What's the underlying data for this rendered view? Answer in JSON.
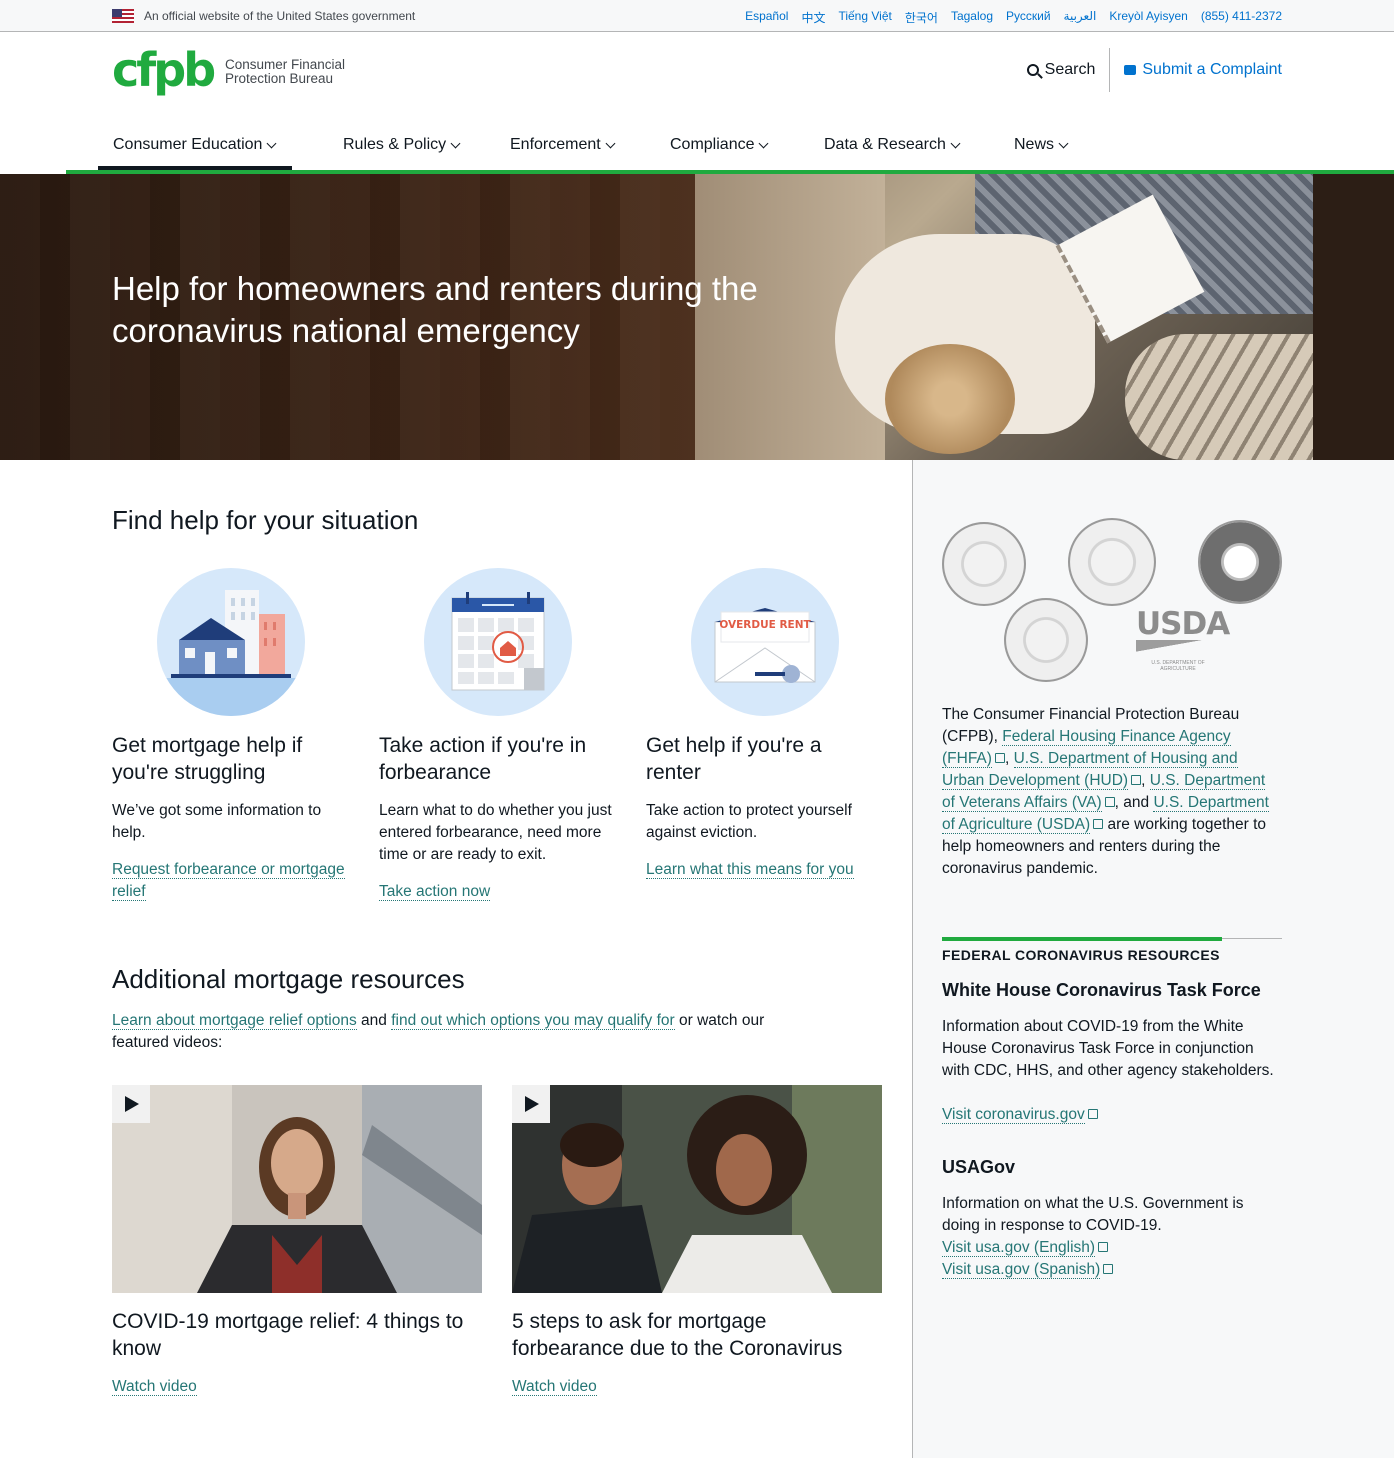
{
  "govbar": {
    "text": "An official website of the United States government",
    "languages": [
      "Español",
      "中文",
      "Tiếng Việt",
      "한국어",
      "Tagalog",
      "Русский",
      "العربية",
      "Kreyòl Ayisyen",
      "(855) 411-2372"
    ]
  },
  "header": {
    "logo_mark": "cfpb",
    "logo_text_1": "Consumer Financial",
    "logo_text_2": "Protection Bureau",
    "search_label": "Search",
    "complaint_label": "Submit a Complaint"
  },
  "nav": {
    "items": [
      "Consumer Education",
      "Rules & Policy",
      "Enforcement",
      "Compliance",
      "Data & Research",
      "News"
    ]
  },
  "hero": {
    "title": "Help for homeowners and renters during the coronavirus national emergency"
  },
  "situation": {
    "heading": "Find help for your situation",
    "cards": [
      {
        "title": "Get mortgage help if you're struggling",
        "text": "We’ve got some information to help.",
        "link": "Request forbearance or mortgage relief"
      },
      {
        "title": "Take action if you're in forbearance",
        "text": "Learn what to do whether you just entered forbearance, need more time or are ready to exit.",
        "link": "Take action now"
      },
      {
        "title": "Get help if you're a renter",
        "text": "Take action to protect yourself against eviction.",
        "link": "Learn what this means for you",
        "icon_text": "OVERDUE RENT"
      }
    ]
  },
  "resources": {
    "heading": "Additional mortgage resources",
    "intro_link_1": "Learn about mortgage relief options",
    "intro_mid": " and ",
    "intro_link_2": "find out which options you may qualify for",
    "intro_end": " or watch our featured videos:",
    "videos": [
      {
        "title": "COVID-19 mortgage relief: 4 things to know",
        "link": "Watch video"
      },
      {
        "title": "5 steps to ask for mortgage forbearance due to the Coronavirus",
        "link": "Watch video"
      }
    ]
  },
  "sidebar": {
    "usda_word": "USDA",
    "usda_sub": "U.S. DEPARTMENT OF AGRICULTURE",
    "p1_start": "The Consumer Financial Protection Bureau (CFPB), ",
    "p1_link_fhfa": "Federal Housing Finance Agency (FHFA)",
    "p1_sep1": ", ",
    "p1_link_hud": "U.S. Department of Housing and Urban Development (HUD)",
    "p1_sep2": ", ",
    "p1_link_va": "U.S. Department of Veterans Affairs (VA)",
    "p1_sep3": ", and ",
    "p1_link_usda": "U.S. Department of Agriculture (USDA)",
    "p1_end": " are working together to help homeowners and renters during the coronavirus pandemic.",
    "resources_heading": "FEDERAL CORONAVIRUS RESOURCES",
    "wh_title": "White House Coronavirus Task Force",
    "wh_text": "Information about COVID-19 from the White House Coronavirus Task Force in conjunction with CDC, HHS, and other agency stakeholders.",
    "wh_link": "Visit coronavirus.gov",
    "usagov_title": "USAGov",
    "usagov_text": "Information on what the U.S. Government is doing in response to COVID-19.",
    "usagov_link_en": "Visit usa.gov (English)",
    "usagov_link_es": "Visit usa.gov (Spanish)"
  },
  "colors": {
    "brand_green": "#20aa3f",
    "link_teal": "#257675",
    "pacific_blue": "#0072ce"
  }
}
